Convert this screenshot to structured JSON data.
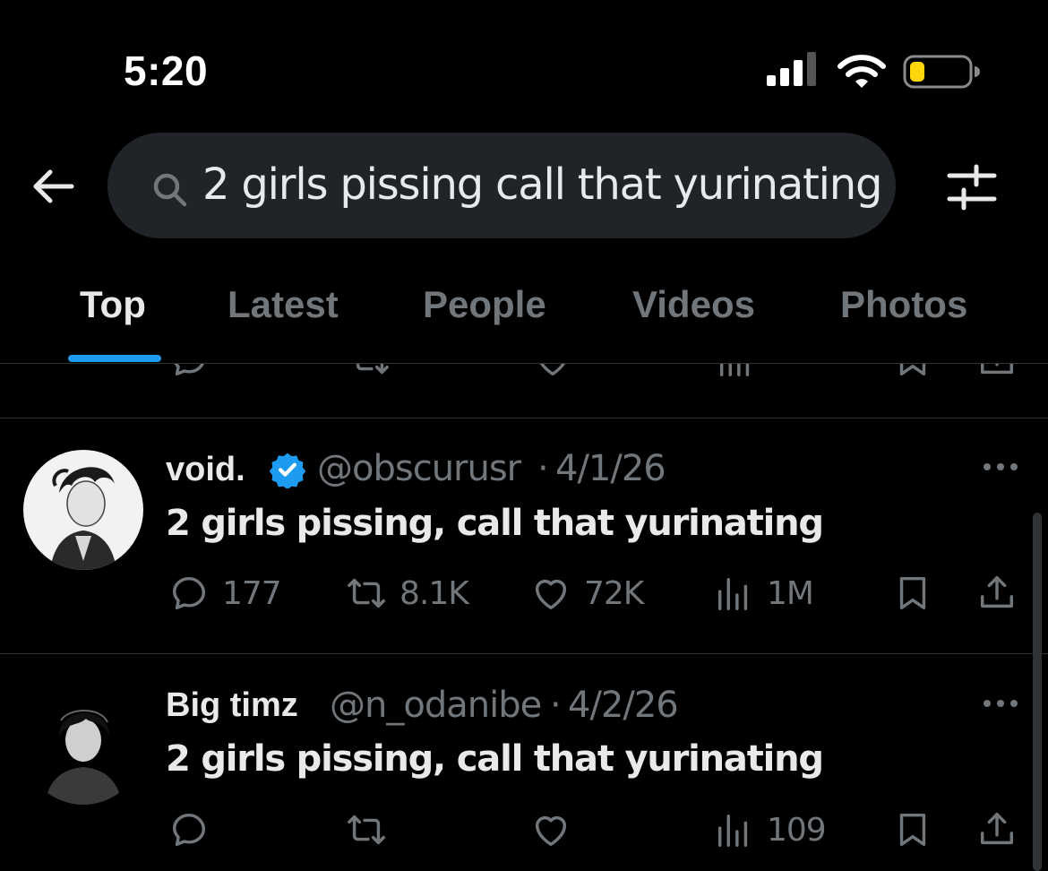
{
  "status_bar": {
    "time": "5:20"
  },
  "search": {
    "query": "2 girls pissing call that yurinating"
  },
  "tabs": [
    {
      "label": "Top",
      "active": true
    },
    {
      "label": "Latest",
      "active": false
    },
    {
      "label": "People",
      "active": false
    },
    {
      "label": "Videos",
      "active": false
    },
    {
      "label": "Photos",
      "active": false
    }
  ],
  "tweets": [
    {
      "name": "void.",
      "verified": true,
      "handle": "@obscurusr",
      "sep": "·",
      "date": "4/1/26",
      "text": "2 girls pissing, call that yurinating",
      "replies": "177",
      "retweets": "8.1K",
      "likes": "72K",
      "views": "1M"
    },
    {
      "name": "Big timz",
      "verified": false,
      "handle": "@n_odanibe",
      "sep": "·",
      "date": "4/2/26",
      "text": "2 girls pissing, call that yurinating",
      "replies": "",
      "retweets": "",
      "likes": "",
      "views": "109"
    }
  ],
  "colors": {
    "accent": "#1d9bf0",
    "muted": "#71767b",
    "text": "#e7e9ea",
    "background": "#000000",
    "battery": "#ffd60a"
  },
  "icons": [
    "back-arrow-icon",
    "search-icon",
    "filter-sliders-icon",
    "more-icon",
    "reply-icon",
    "retweet-icon",
    "like-icon",
    "views-icon",
    "bookmark-icon",
    "share-icon",
    "verified-badge-icon"
  ]
}
